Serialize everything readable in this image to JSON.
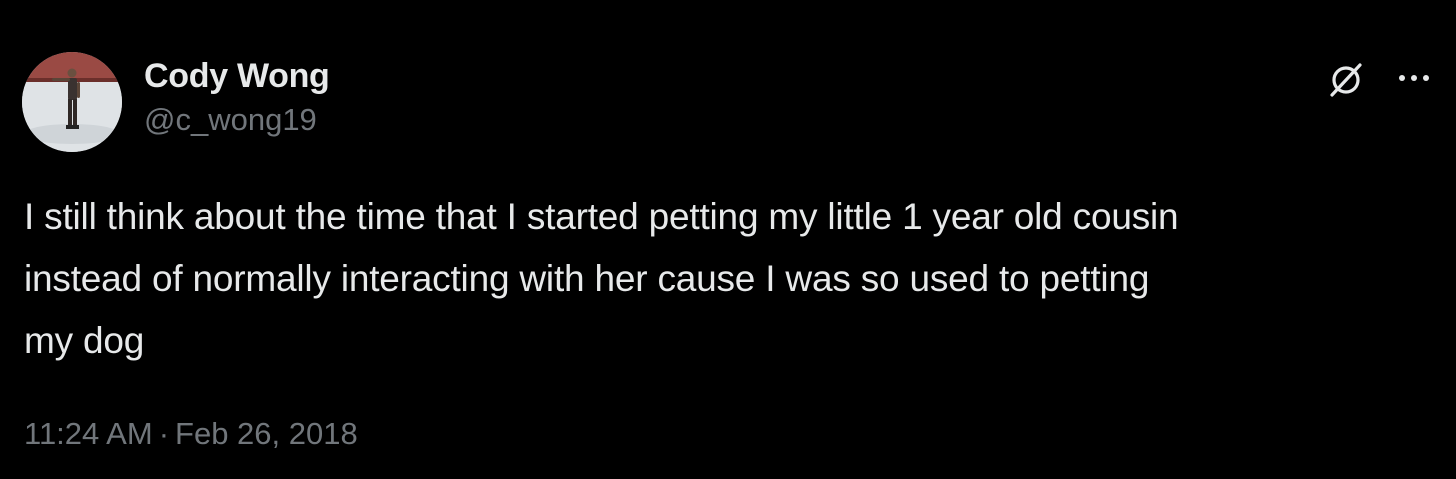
{
  "tweet": {
    "author": {
      "display_name": "Cody Wong",
      "handle": "@c_wong19"
    },
    "text": "I still think about the time that I started petting my little 1 year old cousin\ninstead of normally interacting with her cause I was so used to petting\nmy dog",
    "time": "11:24 AM",
    "separator": "·",
    "date": "Feb 26, 2018"
  },
  "icons": {
    "grok": "grok-icon",
    "more": "more-icon"
  },
  "colors": {
    "background": "#000000",
    "primary_text": "#e7e9ea",
    "secondary_text": "#71767b"
  }
}
